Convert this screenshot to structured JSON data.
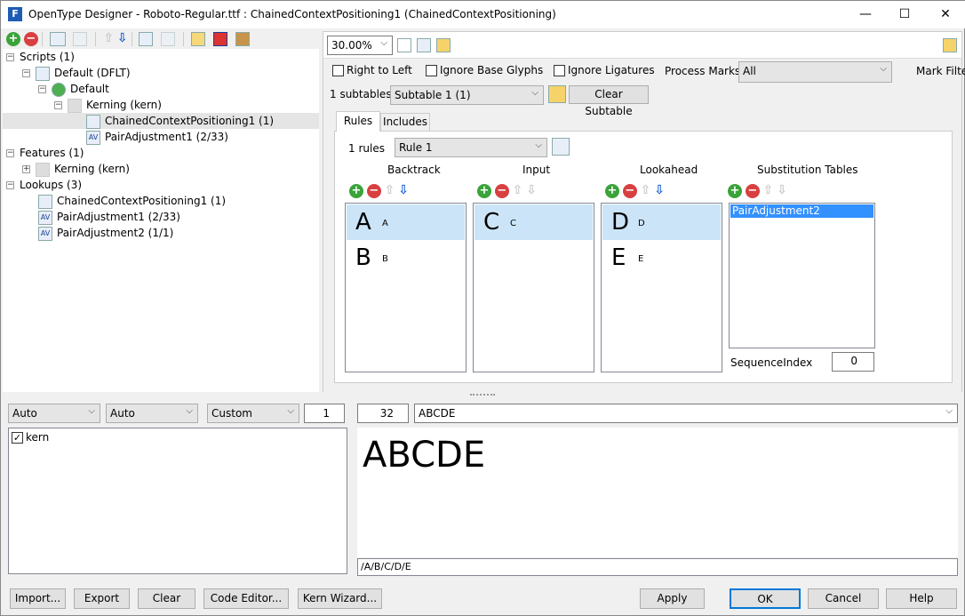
{
  "window": {
    "title": "OpenType Designer - Roboto-Regular.ttf : ChainedContextPositioning1 (ChainedContextPositioning)",
    "app_icon": "F",
    "minimize": "—",
    "maximize": "☐",
    "close": "✕"
  },
  "tree": {
    "nodes": [
      {
        "label": "Scripts (1)",
        "icon": "none"
      },
      {
        "label": "Default (DFLT)",
        "icon": "script-icon"
      },
      {
        "label": "Default",
        "icon": "globe-icon"
      },
      {
        "label": "Kerning (kern)",
        "icon": "feature-icon"
      },
      {
        "label": "ChainedContextPositioning1 (1)",
        "icon": "chain-icon"
      },
      {
        "label": "PairAdjustment1 (2/33)",
        "icon": "pair-icon"
      },
      {
        "label": "Features (1)",
        "icon": "none"
      },
      {
        "label": "Kerning (kern)",
        "icon": "feature-icon"
      },
      {
        "label": "Lookups (3)",
        "icon": "none"
      },
      {
        "label": "ChainedContextPositioning1 (1)",
        "icon": "chain-icon"
      },
      {
        "label": "PairAdjustment1 (2/33)",
        "icon": "pair-icon"
      },
      {
        "label": "PairAdjustment2 (1/1)",
        "icon": "pair-icon"
      }
    ]
  },
  "editor": {
    "zoom": "30.00%",
    "right_to_left": "Right to Left",
    "ignore_base": "Ignore Base Glyphs",
    "ignore_lig": "Ignore Ligatures",
    "process_marks_label": "Process Marks:",
    "process_marks": "All",
    "mark_filter": "Mark Filte",
    "subtables_count": "1 subtables",
    "subtable": "Subtable 1 (1)",
    "clear_subtable": "Clear Subtable",
    "tabs": [
      "Rules",
      "Includes"
    ],
    "rules_count": "1 rules",
    "rule": "Rule 1",
    "columns": {
      "backtrack": "Backtrack",
      "input": "Input",
      "lookahead": "Lookahead",
      "subst": "Substitution Tables"
    },
    "backtrack": [
      {
        "glyph": "A",
        "name": "A"
      },
      {
        "glyph": "B",
        "name": "B"
      }
    ],
    "input": [
      {
        "glyph": "C",
        "name": "C"
      }
    ],
    "lookahead": [
      {
        "glyph": "D",
        "name": "D"
      },
      {
        "glyph": "E",
        "name": "E"
      }
    ],
    "subst": [
      "PairAdjustment2"
    ],
    "sequence_index_label": "SequenceIndex",
    "sequence_index": "0"
  },
  "preview": {
    "script": "Auto",
    "language": "Auto",
    "mode": "Custom",
    "count": "1",
    "size": "32",
    "text": "ABCDE",
    "features": [
      {
        "label": "kern",
        "checked": true
      }
    ],
    "rendered": "ABCDE",
    "glyph_string": "/A/B/C/D/E"
  },
  "buttons": {
    "import": "Import...",
    "export": "Export",
    "clear": "Clear",
    "code_editor": "Code Editor...",
    "kern_wizard": "Kern Wizard...",
    "apply": "Apply",
    "ok": "OK",
    "cancel": "Cancel",
    "help": "Help"
  },
  "symbols": {
    "plus": "+",
    "minus": "−",
    "up": "⇧",
    "down": "⇩",
    "chev": "⌵",
    "check": "✓",
    "tree_minus": "−",
    "tree_plus": "+"
  }
}
